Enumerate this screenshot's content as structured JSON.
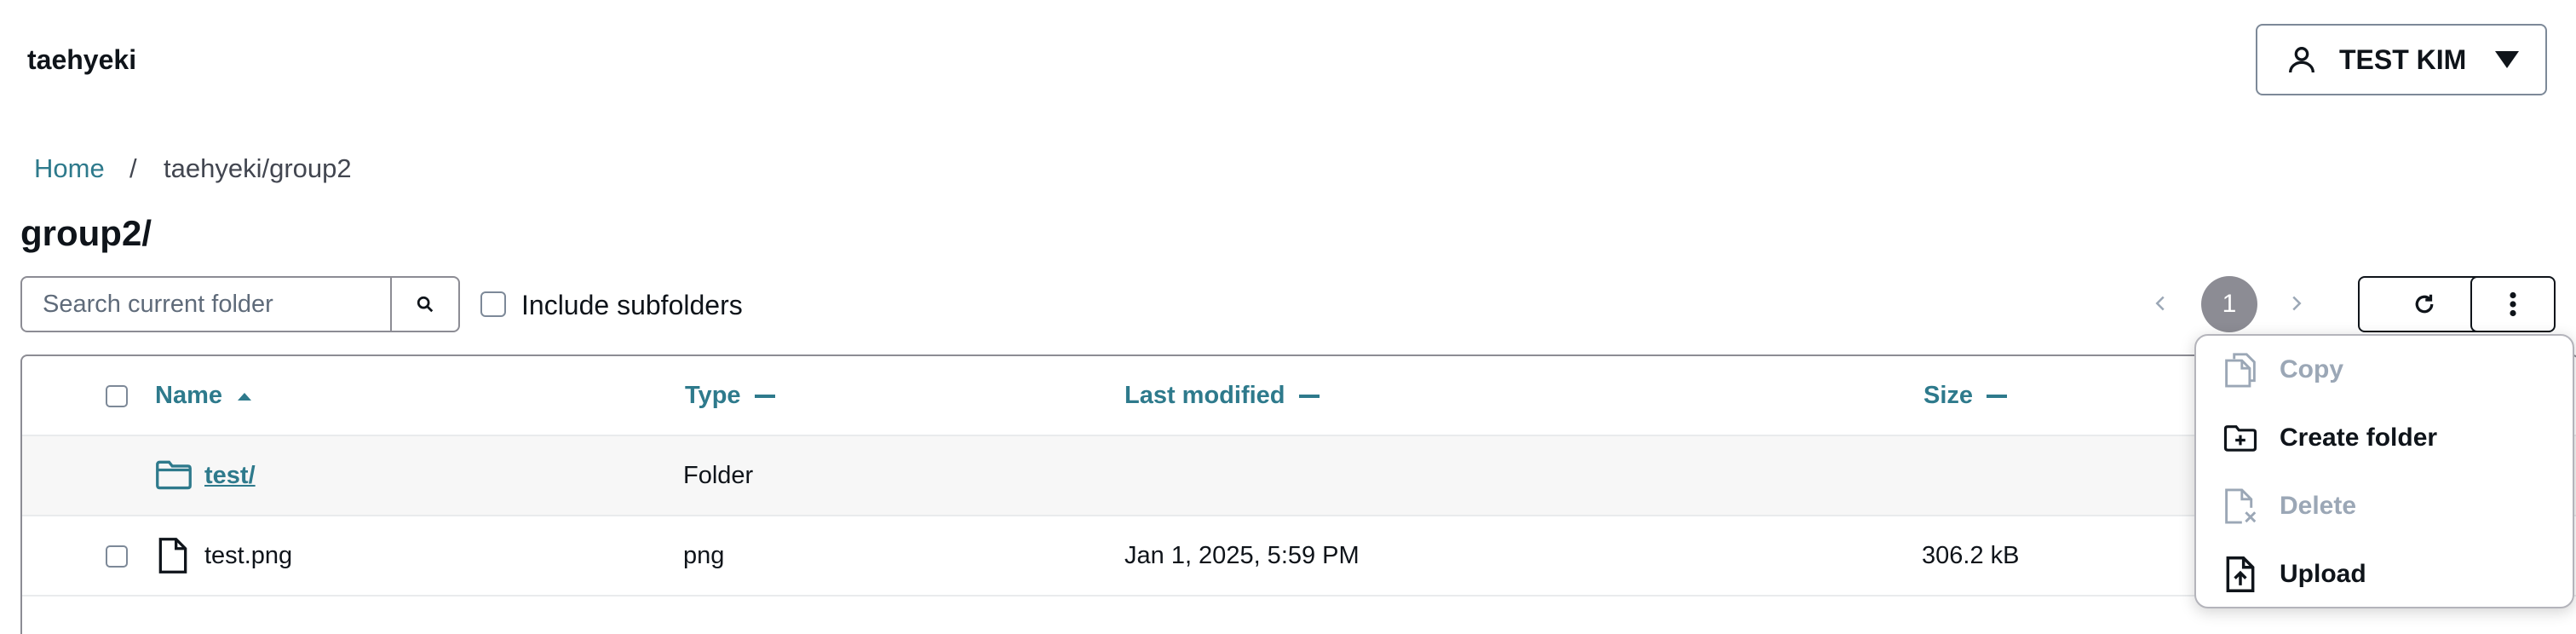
{
  "header": {
    "brand": "taehyeki",
    "user_name": "TEST KIM"
  },
  "breadcrumb": {
    "home": "Home",
    "separator": "/",
    "current": "taehyeki/group2"
  },
  "page_title": "group2/",
  "toolbar": {
    "search_placeholder": "Search current folder",
    "search_value": "",
    "include_subfolders_label": "Include subfolders",
    "include_subfolders_checked": false,
    "current_page": "1"
  },
  "table": {
    "columns": [
      {
        "label": "Name",
        "sort": "ascending"
      },
      {
        "label": "Type",
        "sort": "none"
      },
      {
        "label": "Last modified",
        "sort": "none"
      },
      {
        "label": "Size",
        "sort": "none"
      }
    ],
    "rows": [
      {
        "name": "test/",
        "kind": "folder",
        "type": "Folder",
        "modified": "",
        "size": ""
      },
      {
        "name": "test.png",
        "kind": "file",
        "type": "png",
        "modified": "Jan 1, 2025, 5:59 PM",
        "size": "306.2 kB"
      }
    ]
  },
  "actions_menu": {
    "items": [
      {
        "label": "Copy",
        "icon": "copy-icon",
        "disabled": true
      },
      {
        "label": "Create folder",
        "icon": "folder-plus-icon",
        "disabled": false
      },
      {
        "label": "Delete",
        "icon": "file-delete-icon",
        "disabled": true
      },
      {
        "label": "Upload",
        "icon": "upload-icon",
        "disabled": false
      }
    ]
  },
  "colors": {
    "link": "#2e7a8c",
    "text": "#0f141a",
    "border": "#8c8c94",
    "disabled": "#9ba7b6",
    "page_badge": "#8c8c94"
  }
}
